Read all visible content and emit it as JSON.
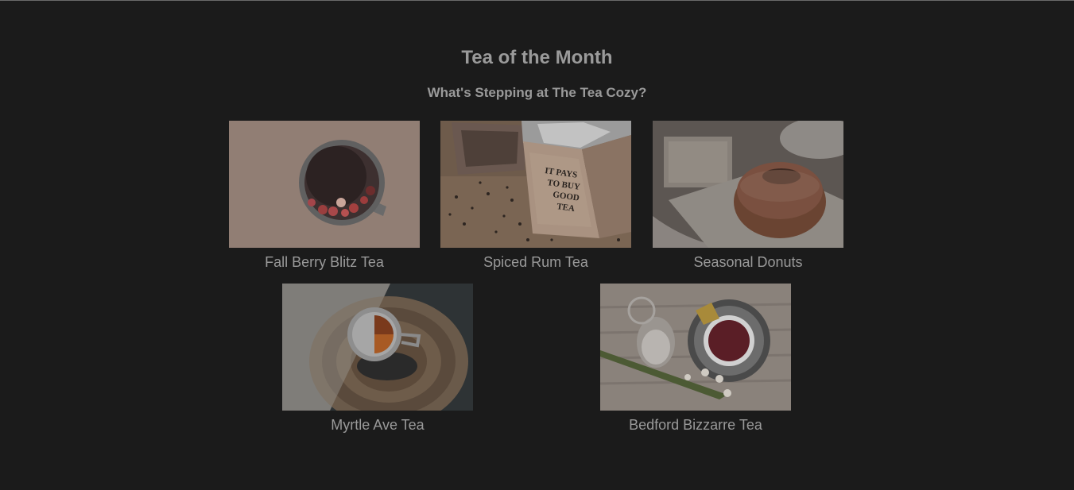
{
  "header": {
    "title": "Tea of the Month",
    "subtitle": "What's Stepping at The Tea Cozy?"
  },
  "items": [
    {
      "caption": "Fall Berry Blitz Tea",
      "image": "cup of berry tea from above"
    },
    {
      "caption": "Spiced Rum Tea",
      "image": "wooden box with loose tea",
      "box_text": [
        "IT PAYS",
        "TO BUY",
        "GOOD",
        "TEA"
      ]
    },
    {
      "caption": "Seasonal Donuts",
      "image": "sugar donut on plate"
    },
    {
      "caption": "Myrtle Ave Tea",
      "image": "tea cup on wooden tray"
    },
    {
      "caption": "Bedford Bizzarre Tea",
      "image": "red tea with sugar jar"
    }
  ]
}
